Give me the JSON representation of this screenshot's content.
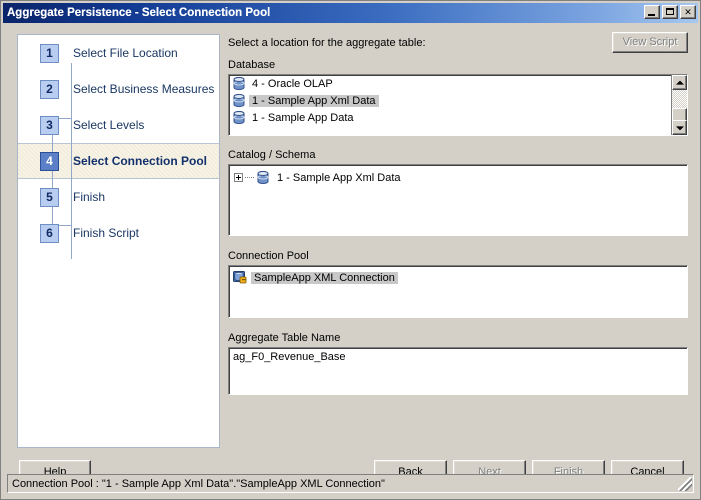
{
  "window": {
    "title": "Aggregate Persistence - Select Connection Pool",
    "controls": {
      "minimize": "Minimize",
      "maximize": "Maximize",
      "close": "Close"
    }
  },
  "sidebar": {
    "steps": [
      {
        "number": "1",
        "label": "Select File Location",
        "active": false
      },
      {
        "number": "2",
        "label": "Select Business Measures",
        "active": false
      },
      {
        "number": "3",
        "label": "Select Levels",
        "active": false
      },
      {
        "number": "4",
        "label": "Select Connection Pool",
        "active": true
      },
      {
        "number": "5",
        "label": "Finish",
        "active": false
      },
      {
        "number": "6",
        "label": "Finish Script",
        "active": false
      }
    ]
  },
  "main": {
    "instruction": "Select a location for the aggregate table:",
    "view_script_button": "View Script",
    "database": {
      "label": "Database",
      "items": [
        {
          "text": "4 - Oracle OLAP",
          "selected": false
        },
        {
          "text": "1 - Sample App Xml Data",
          "selected": true
        },
        {
          "text": "1 - Sample App Data",
          "selected": false
        }
      ]
    },
    "catalog_schema": {
      "label": "Catalog / Schema",
      "items": [
        {
          "text": "1 - Sample App Xml Data",
          "expander": "+",
          "selected": false
        }
      ]
    },
    "connection_pool": {
      "label": "Connection Pool",
      "items": [
        {
          "text": "SampleApp XML Connection",
          "selected": true
        }
      ]
    },
    "aggregate_table_name": {
      "label": "Aggregate Table Name",
      "value": "ag_F0_Revenue_Base"
    }
  },
  "footer": {
    "help": "Help",
    "back": "Back",
    "next": "Next",
    "finish": "Finish",
    "cancel": "Cancel"
  },
  "statusbar": {
    "text": "Connection Pool : \"1 - Sample App Xml Data\".\"SampleApp XML Connection\""
  },
  "colors": {
    "title_start": "#0a246a",
    "title_end": "#a6c8f0",
    "face": "#d4d0c8",
    "step_box": "#b9cdf0",
    "step_box_active": "#5b80c8",
    "step_text": "#1a3763",
    "selection": "#c8c8c8",
    "disabled_text": "#808080"
  }
}
